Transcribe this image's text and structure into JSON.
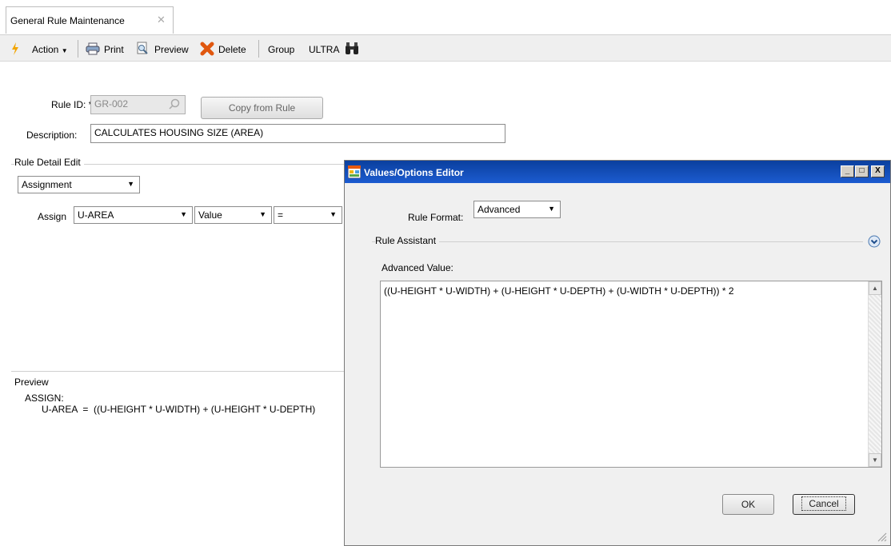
{
  "tab": {
    "title": "General Rule Maintenance",
    "close": "✕"
  },
  "toolbar": {
    "action": "Action",
    "print": "Print",
    "preview": "Preview",
    "delete": "Delete",
    "group": "Group",
    "ultra": "ULTRA"
  },
  "form": {
    "rule_id_label": "Rule ID: *",
    "rule_id_value": "GR-002",
    "copy_button": "Copy from Rule",
    "description_label": "Description:",
    "description_value": "CALCULATES HOUSING SIZE (AREA)"
  },
  "rule_detail": {
    "group_label": "Rule Detail Edit",
    "type_value": "Assignment",
    "assign_label": "Assign",
    "field_value": "U-AREA",
    "source_value": "Value",
    "operator_value": "="
  },
  "preview": {
    "group_label": "Preview",
    "line1": "ASSIGN:",
    "line2": "U-AREA  =  ((U-HEIGHT * U-WIDTH) + (U-HEIGHT * U-DEPTH)"
  },
  "dialog": {
    "title": "Values/Options Editor",
    "rule_format_label": "Rule Format:",
    "rule_format_value": "Advanced",
    "assistant_label": "Rule Assistant",
    "advanced_label": "Advanced Value:",
    "advanced_value": "((U-HEIGHT * U-WIDTH) + (U-HEIGHT * U-DEPTH) + (U-WIDTH * U-DEPTH)) * 2",
    "ok": "OK",
    "cancel": "Cancel",
    "minimize": "_",
    "maximize": "□",
    "close": "X"
  }
}
